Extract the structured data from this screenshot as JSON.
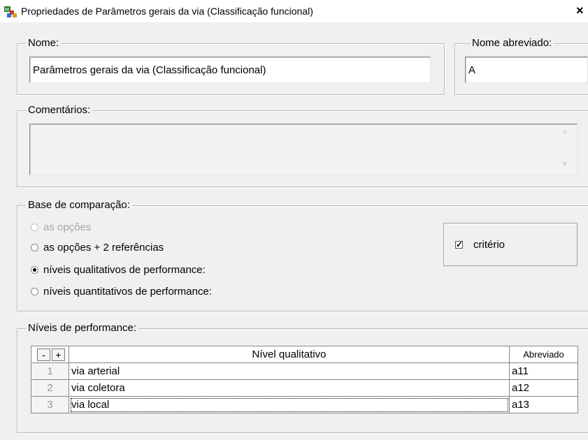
{
  "window": {
    "title": "Propriedades de  Parâmetros gerais da via (Classificação funcional)",
    "close_label": "×",
    "icon": "app-icon"
  },
  "nome": {
    "legend": "Nome:",
    "value": "Parâmetros gerais da via (Classificação funcional)"
  },
  "nome_abreviado": {
    "legend": "Nome abreviado:",
    "value": "A"
  },
  "comentarios": {
    "legend": "Comentários:",
    "value": "",
    "scroll_up": "^",
    "scroll_down": "v"
  },
  "base_comparacao": {
    "legend": "Base de comparação:",
    "options": [
      {
        "label": "as opções",
        "checked": false,
        "disabled": true
      },
      {
        "label": "as opções + 2 referências",
        "checked": false,
        "disabled": false
      },
      {
        "label": "níveis qualitativos de performance:",
        "checked": true,
        "disabled": false
      },
      {
        "label": "níveis quantitativos de performance:",
        "checked": false,
        "disabled": false
      }
    ],
    "criterio": {
      "label": "critério",
      "checked": true,
      "mark": "✓"
    }
  },
  "niveis": {
    "legend": "Níveis de performance:",
    "minus_label": "-",
    "plus_label": "+",
    "header_level": "Nível qualitativo",
    "header_abbr": "Abreviado",
    "rows": [
      {
        "num": "1",
        "level": "via arterial",
        "abbr": "a11"
      },
      {
        "num": "2",
        "level": "via coletora",
        "abbr": "a12"
      },
      {
        "num": "3",
        "level": "via local",
        "abbr": "a13"
      }
    ]
  }
}
